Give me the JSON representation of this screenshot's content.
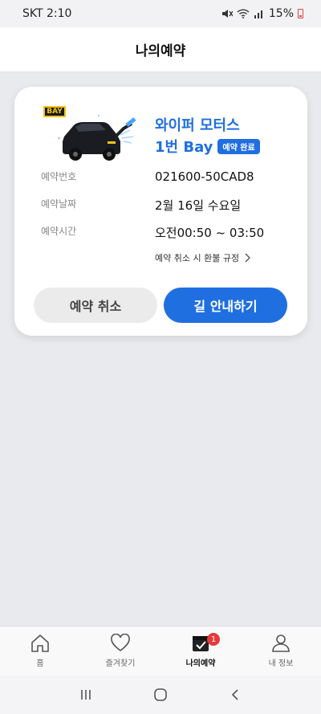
{
  "status_bar": {
    "carrier": "SKT",
    "time": "2:10",
    "battery": "15%"
  },
  "header": {
    "title": "나의예약"
  },
  "reservation": {
    "bay_tag": "BAY",
    "shop_name": "와이퍼 모터스",
    "bay_name": "1번 Bay",
    "status_badge": "예약 완료",
    "rows": [
      {
        "label": "예약번호",
        "value": "021600-50CAD8"
      },
      {
        "label": "예약날짜",
        "value": "2월 16일 수요일"
      },
      {
        "label": "예약시간",
        "value": "오전00:50 ~ 03:50"
      }
    ],
    "refund_policy_link": "예약 취소 시 환불 규정",
    "cancel_button": "예약 취소",
    "navigate_button": "길 안내하기"
  },
  "tabbar": {
    "items": [
      {
        "label": "홈",
        "icon": "home-icon"
      },
      {
        "label": "즐겨찾기",
        "icon": "heart-icon"
      },
      {
        "label": "나의예약",
        "icon": "reservation-icon",
        "badge": "1",
        "active": true
      },
      {
        "label": "내 정보",
        "icon": "person-icon"
      }
    ]
  },
  "colors": {
    "accent": "#1f6fe0",
    "badge_red": "#e53a3a",
    "background": "#e9eaee"
  }
}
